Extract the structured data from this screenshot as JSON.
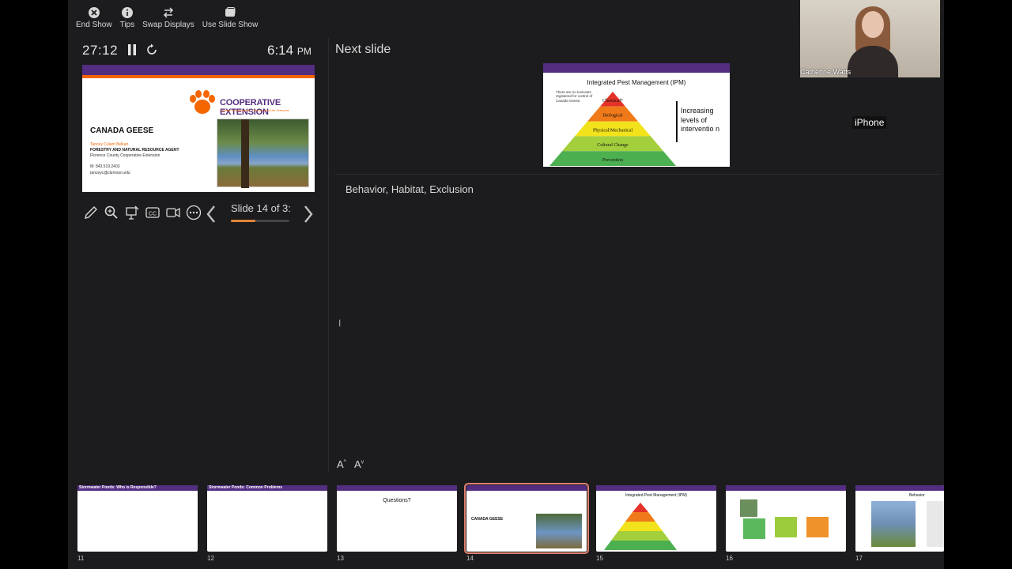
{
  "toolbar": {
    "end_show": "End Show",
    "tips": "Tips",
    "swap_displays": "Swap Displays",
    "use_slide_show": "Use Slide Show"
  },
  "presenter": {
    "elapsed": "27:12",
    "clock_time": "6:14",
    "clock_ampm": "PM",
    "slide_counter": "Slide 14 of 3:",
    "progress_fraction": 0.42,
    "next_label": "Next slide",
    "notes": "Behavior, Habitat, Exclusion"
  },
  "current_slide": {
    "org_title": "COOPERATIVE EXTENSION",
    "org_subtitle": "College of Agriculture, Forestry and Life Sciences",
    "heading": "CANADA GEESE",
    "name": "Tancey Culum Belkan",
    "role": "FORESTRY AND NATURAL RESOURCE AGENT",
    "office": "Florence County Cooperative Extension",
    "phone": "M: 843.519.2403",
    "email": "tanceyc@clemson.edu"
  },
  "next_slide": {
    "title": "Integrated Pest Management (IPM)",
    "note": "There are no toxicants registered for control of Canada Geese.",
    "increasing": "Increasing levels of interventio n",
    "levels": [
      "Chemical*",
      "Biological",
      "Physical/Mechanical",
      "Cultural Change",
      "Prevention"
    ],
    "level_colors": [
      "#e53228",
      "#f07a1a",
      "#f2e21c",
      "#a4cf3c",
      "#4caf50"
    ]
  },
  "thumbnails": [
    {
      "num": "11",
      "title": "Stormwater Ponds: Who is Responsible?"
    },
    {
      "num": "12",
      "title": "Stormwater Ponds: Common Problems"
    },
    {
      "num": "13",
      "title": "Questions?"
    },
    {
      "num": "14",
      "title": "CANADA GEESE"
    },
    {
      "num": "15",
      "title": "Integrated Pest Management (IPM)"
    },
    {
      "num": "16",
      "title": ""
    },
    {
      "num": "17",
      "title": "Behavior"
    }
  ],
  "camera": {
    "participant": "Catherine Watts",
    "device": "iPhone"
  },
  "colors": {
    "clemson_purple": "#522d80",
    "clemson_orange": "#f56600",
    "panel_bg": "#1c1c1e",
    "selected_outline": "#e08070"
  }
}
